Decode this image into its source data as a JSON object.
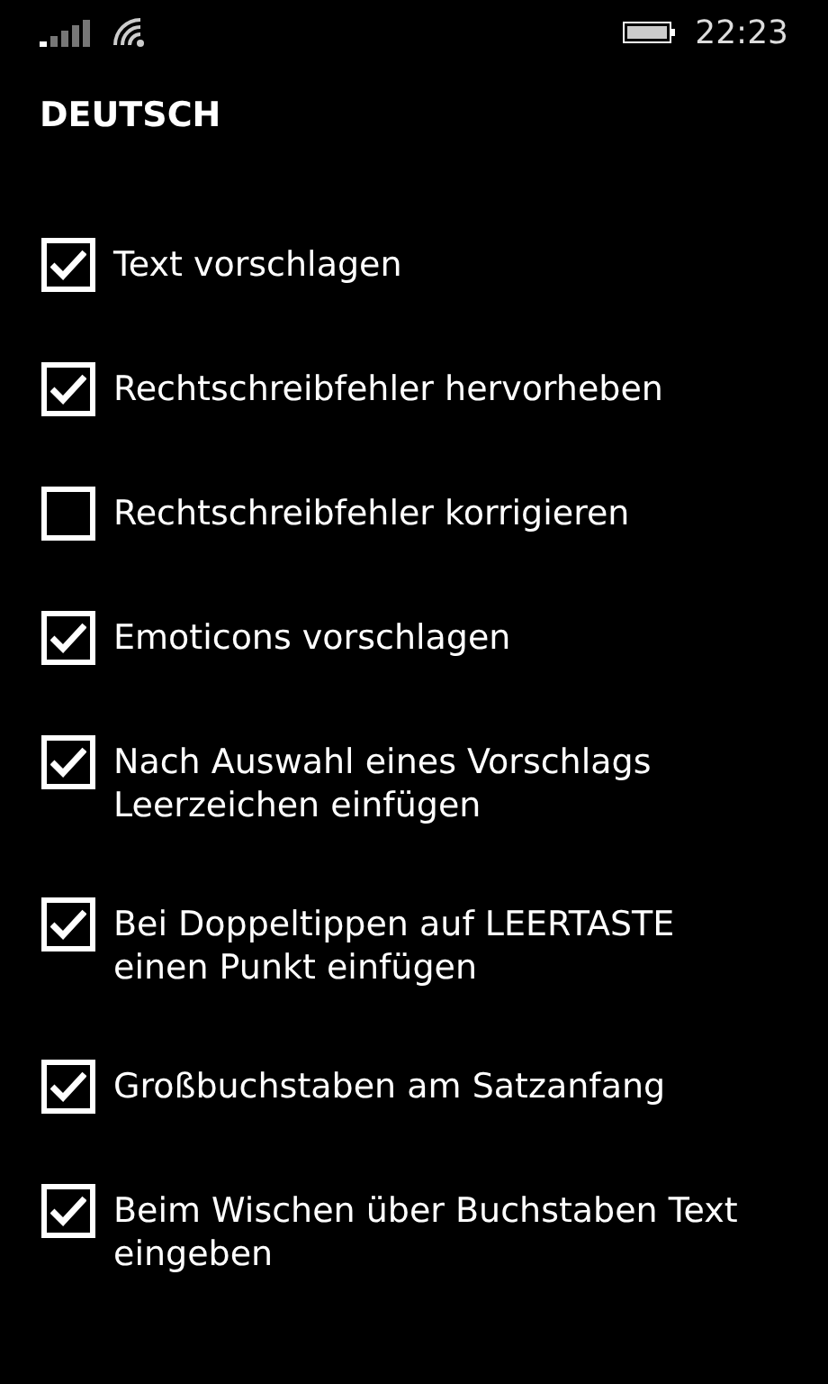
{
  "status_bar": {
    "time": "22:23"
  },
  "title": "DEUTSCH",
  "options": [
    {
      "label": "Text vorschlagen",
      "checked": true
    },
    {
      "label": "Rechtschreibfehler hervorheben",
      "checked": true
    },
    {
      "label": "Rechtschreibfehler korrigieren",
      "checked": false
    },
    {
      "label": "Emoticons vorschlagen",
      "checked": true
    },
    {
      "label": "Nach Auswahl eines Vorschlags Leerzeichen einfügen",
      "checked": true
    },
    {
      "label": "Bei Doppeltippen auf LEERTASTE einen Punkt einfügen",
      "checked": true
    },
    {
      "label": "Großbuchstaben am Satzanfang",
      "checked": true
    },
    {
      "label": "Beim Wischen über Buchstaben Text eingeben",
      "checked": true
    }
  ]
}
